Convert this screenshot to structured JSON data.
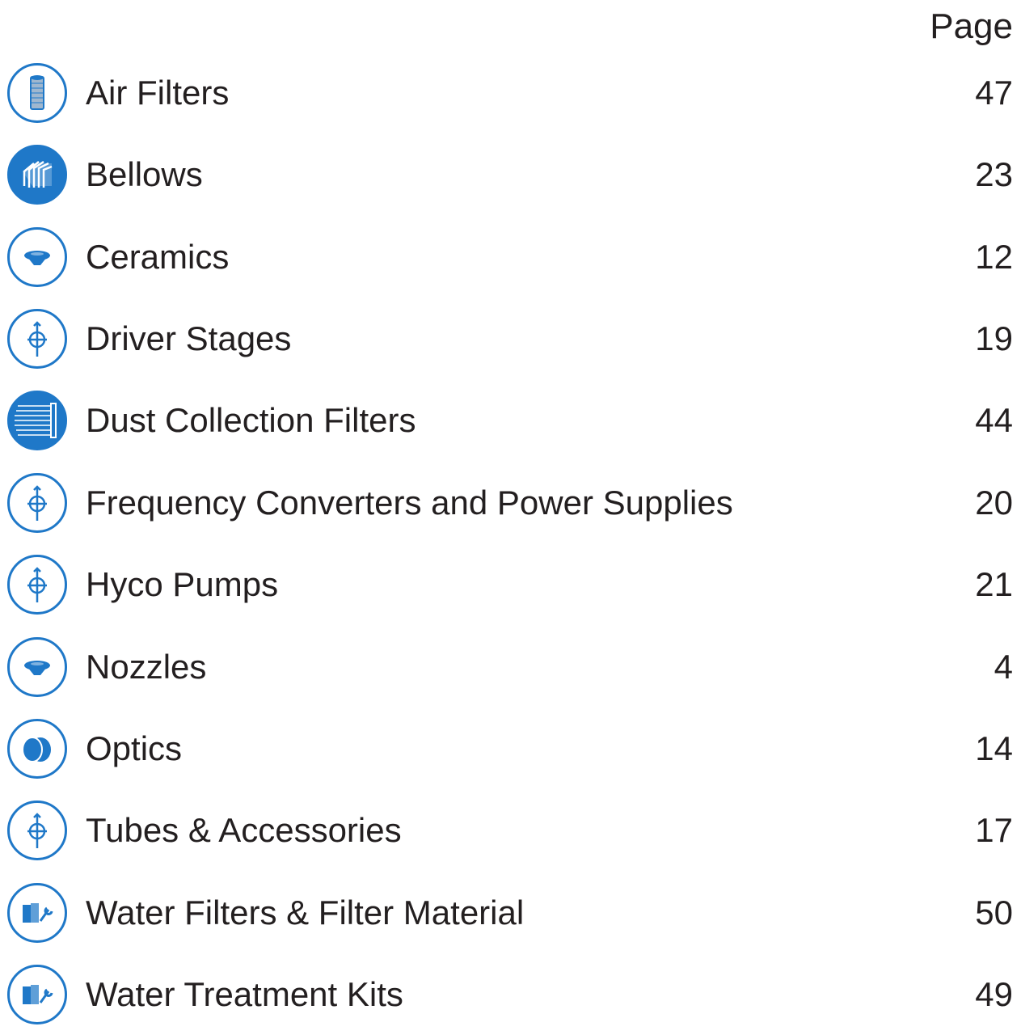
{
  "header": {
    "page_label": "Page"
  },
  "entries": [
    {
      "title": "Air Filters",
      "page": "47",
      "icon": "air-filter-icon"
    },
    {
      "title": "Bellows",
      "page": "23",
      "icon": "bellows-icon"
    },
    {
      "title": "Ceramics",
      "page": "12",
      "icon": "ceramic-icon"
    },
    {
      "title": "Driver Stages",
      "page": "19",
      "icon": "tube-icon"
    },
    {
      "title": "Dust Collection Filters",
      "page": "44",
      "icon": "dust-filter-icon"
    },
    {
      "title": "Frequency Converters and Power Supplies",
      "page": "20",
      "icon": "tube-icon"
    },
    {
      "title": "Hyco Pumps",
      "page": "21",
      "icon": "tube-icon"
    },
    {
      "title": "Nozzles",
      "page": "4",
      "icon": "ceramic-icon"
    },
    {
      "title": "Optics",
      "page": "14",
      "icon": "optics-icon"
    },
    {
      "title": "Tubes & Accessories",
      "page": "17",
      "icon": "tube-icon"
    },
    {
      "title": "Water Filters & Filter Material",
      "page": "50",
      "icon": "water-kit-icon"
    },
    {
      "title": "Water Treatment Kits",
      "page": "49",
      "icon": "water-kit-icon"
    }
  ],
  "colors": {
    "accent": "#1f78c8",
    "text": "#231f20"
  }
}
